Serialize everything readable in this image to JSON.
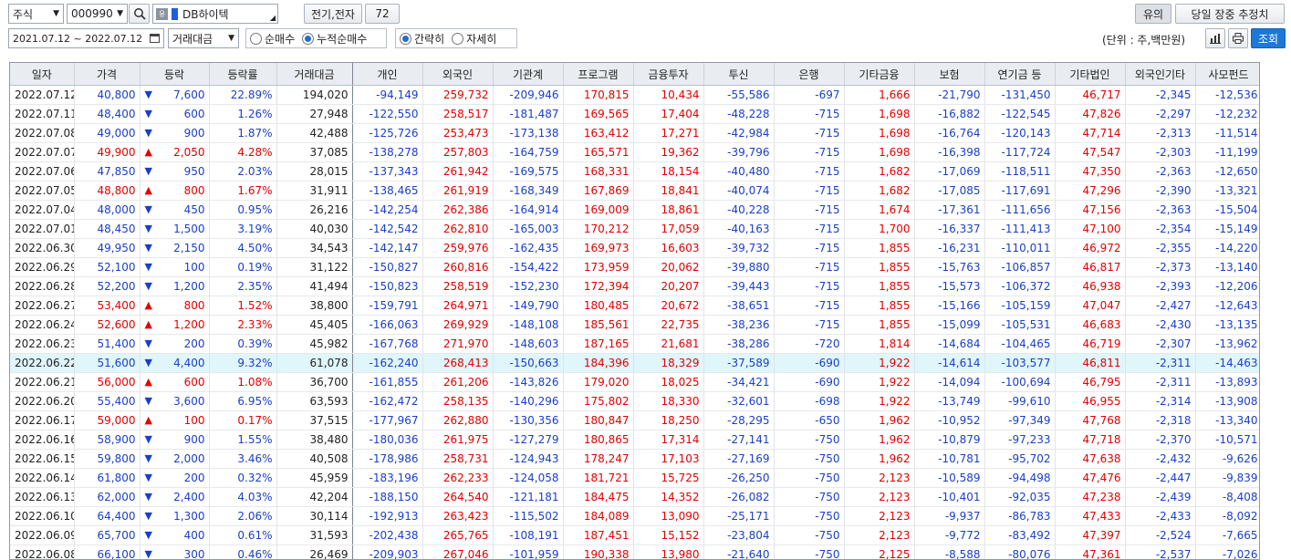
{
  "toolbar": {
    "market": "주식",
    "code": "000990",
    "stock_name": "DB하이텍",
    "sector": "전기,전자",
    "sector_code": "72",
    "notice_btn": "유의",
    "estimate_btn": "당일 장중 추정치",
    "date_range": "2021.07.12 ~ 2022.07.12",
    "value_type": "거래대금",
    "radio_net": "순매수",
    "radio_cum": "누적순매수",
    "radio_simple": "간략히",
    "radio_detail": "자세히",
    "unit": "(단위 : 주,백만원)",
    "query_btn": "조회"
  },
  "columns": [
    "일자",
    "가격",
    "등락",
    "등락률",
    "거래대금",
    "개인",
    "외국인",
    "기관계",
    "프로그램",
    "금융투자",
    "투신",
    "은행",
    "기타금융",
    "보험",
    "연기금 등",
    "기타법인",
    "외국인기타",
    "사모펀드"
  ],
  "rows": [
    [
      "2022.07.12",
      "40,800",
      "▼",
      "7,600",
      "22.89%",
      "194,020",
      "-94,149",
      "259,732",
      "-209,946",
      "170,815",
      "10,434",
      "-55,586",
      "-697",
      "1,666",
      "-21,790",
      "-131,450",
      "46,717",
      "-2,345",
      "-12,536"
    ],
    [
      "2022.07.11",
      "48,400",
      "▼",
      "600",
      "1.26%",
      "27,948",
      "-122,550",
      "258,517",
      "-181,487",
      "169,565",
      "17,404",
      "-48,228",
      "-715",
      "1,698",
      "-16,882",
      "-122,545",
      "47,826",
      "-2,297",
      "-12,232"
    ],
    [
      "2022.07.08",
      "49,000",
      "▼",
      "900",
      "1.87%",
      "42,488",
      "-125,726",
      "253,473",
      "-173,138",
      "163,412",
      "17,271",
      "-42,984",
      "-715",
      "1,698",
      "-16,764",
      "-120,143",
      "47,714",
      "-2,313",
      "-11,514"
    ],
    [
      "2022.07.07",
      "49,900",
      "▲",
      "2,050",
      "4.28%",
      "37,085",
      "-138,278",
      "257,803",
      "-164,759",
      "165,571",
      "19,362",
      "-39,796",
      "-715",
      "1,698",
      "-16,398",
      "-117,724",
      "47,547",
      "-2,303",
      "-11,199"
    ],
    [
      "2022.07.06",
      "47,850",
      "▼",
      "950",
      "2.03%",
      "28,015",
      "-137,343",
      "261,942",
      "-169,575",
      "168,331",
      "18,154",
      "-40,480",
      "-715",
      "1,682",
      "-17,069",
      "-118,511",
      "47,350",
      "-2,363",
      "-12,650"
    ],
    [
      "2022.07.05",
      "48,800",
      "▲",
      "800",
      "1.67%",
      "31,911",
      "-138,465",
      "261,919",
      "-168,349",
      "167,869",
      "18,841",
      "-40,074",
      "-715",
      "1,682",
      "-17,085",
      "-117,691",
      "47,296",
      "-2,390",
      "-13,321"
    ],
    [
      "2022.07.04",
      "48,000",
      "▼",
      "450",
      "0.95%",
      "26,216",
      "-142,254",
      "262,386",
      "-164,914",
      "169,009",
      "18,861",
      "-40,228",
      "-715",
      "1,674",
      "-17,361",
      "-111,656",
      "47,156",
      "-2,363",
      "-15,504"
    ],
    [
      "2022.07.01",
      "48,450",
      "▼",
      "1,500",
      "3.19%",
      "40,030",
      "-142,542",
      "262,810",
      "-165,003",
      "170,212",
      "17,059",
      "-40,163",
      "-715",
      "1,700",
      "-16,337",
      "-111,413",
      "47,100",
      "-2,354",
      "-15,149"
    ],
    [
      "2022.06.30",
      "49,950",
      "▼",
      "2,150",
      "4.50%",
      "34,543",
      "-142,147",
      "259,976",
      "-162,435",
      "169,973",
      "16,603",
      "-39,732",
      "-715",
      "1,855",
      "-16,231",
      "-110,011",
      "46,972",
      "-2,355",
      "-14,220"
    ],
    [
      "2022.06.29",
      "52,100",
      "▼",
      "100",
      "0.19%",
      "31,122",
      "-150,827",
      "260,816",
      "-154,422",
      "173,959",
      "20,062",
      "-39,880",
      "-715",
      "1,855",
      "-15,763",
      "-106,857",
      "46,817",
      "-2,373",
      "-13,140"
    ],
    [
      "2022.06.28",
      "52,200",
      "▼",
      "1,200",
      "2.35%",
      "41,494",
      "-150,823",
      "258,519",
      "-152,230",
      "172,394",
      "20,207",
      "-39,443",
      "-715",
      "1,855",
      "-15,573",
      "-106,372",
      "46,938",
      "-2,393",
      "-12,206"
    ],
    [
      "2022.06.27",
      "53,400",
      "▲",
      "800",
      "1.52%",
      "38,800",
      "-159,791",
      "264,971",
      "-149,790",
      "180,485",
      "20,672",
      "-38,651",
      "-715",
      "1,855",
      "-15,166",
      "-105,159",
      "47,047",
      "-2,427",
      "-12,643"
    ],
    [
      "2022.06.24",
      "52,600",
      "▲",
      "1,200",
      "2.33%",
      "45,405",
      "-166,063",
      "269,929",
      "-148,108",
      "185,561",
      "22,735",
      "-38,236",
      "-715",
      "1,855",
      "-15,099",
      "-105,531",
      "46,683",
      "-2,430",
      "-13,135"
    ],
    [
      "2022.06.23",
      "51,400",
      "▼",
      "200",
      "0.39%",
      "45,982",
      "-167,768",
      "271,970",
      "-148,603",
      "187,165",
      "21,681",
      "-38,286",
      "-720",
      "1,814",
      "-14,684",
      "-104,465",
      "46,719",
      "-2,307",
      "-13,962"
    ],
    [
      "2022.06.22",
      "51,600",
      "▼",
      "4,400",
      "9.32%",
      "61,078",
      "-162,240",
      "268,413",
      "-150,663",
      "184,396",
      "18,329",
      "-37,589",
      "-690",
      "1,922",
      "-14,614",
      "-103,577",
      "46,811",
      "-2,311",
      "-14,463"
    ],
    [
      "2022.06.21",
      "56,000",
      "▲",
      "600",
      "1.08%",
      "36,700",
      "-161,855",
      "261,206",
      "-143,826",
      "179,020",
      "18,025",
      "-34,421",
      "-690",
      "1,922",
      "-14,094",
      "-100,694",
      "46,795",
      "-2,311",
      "-13,893"
    ],
    [
      "2022.06.20",
      "55,400",
      "▼",
      "3,600",
      "6.95%",
      "63,593",
      "-162,472",
      "258,135",
      "-140,296",
      "175,802",
      "18,330",
      "-32,601",
      "-698",
      "1,922",
      "-13,749",
      "-99,610",
      "46,955",
      "-2,314",
      "-13,908"
    ],
    [
      "2022.06.17",
      "59,000",
      "▲",
      "100",
      "0.17%",
      "37,515",
      "-177,967",
      "262,880",
      "-130,356",
      "180,847",
      "18,250",
      "-28,295",
      "-650",
      "1,962",
      "-10,952",
      "-97,349",
      "47,768",
      "-2,318",
      "-13,340"
    ],
    [
      "2022.06.16",
      "58,900",
      "▼",
      "900",
      "1.55%",
      "38,480",
      "-180,036",
      "261,975",
      "-127,279",
      "180,865",
      "17,314",
      "-27,141",
      "-750",
      "1,962",
      "-10,879",
      "-97,233",
      "47,718",
      "-2,370",
      "-10,571"
    ],
    [
      "2022.06.15",
      "59,800",
      "▼",
      "2,000",
      "3.46%",
      "40,508",
      "-178,986",
      "258,731",
      "-124,943",
      "178,247",
      "17,103",
      "-27,169",
      "-750",
      "1,962",
      "-10,781",
      "-95,702",
      "47,638",
      "-2,432",
      "-9,626"
    ],
    [
      "2022.06.14",
      "61,800",
      "▼",
      "200",
      "0.32%",
      "45,959",
      "-183,196",
      "262,233",
      "-124,058",
      "181,721",
      "15,725",
      "-26,250",
      "-750",
      "2,123",
      "-10,589",
      "-94,498",
      "47,476",
      "-2,447",
      "-9,839"
    ],
    [
      "2022.06.13",
      "62,000",
      "▼",
      "2,400",
      "4.03%",
      "42,204",
      "-188,150",
      "264,540",
      "-121,181",
      "184,475",
      "14,352",
      "-26,082",
      "-750",
      "2,123",
      "-10,401",
      "-92,035",
      "47,238",
      "-2,439",
      "-8,408"
    ],
    [
      "2022.06.10",
      "64,400",
      "▼",
      "1,300",
      "2.06%",
      "30,114",
      "-192,913",
      "263,423",
      "-115,502",
      "184,089",
      "13,090",
      "-25,171",
      "-750",
      "2,123",
      "-9,937",
      "-86,783",
      "47,433",
      "-2,433",
      "-8,092"
    ],
    [
      "2022.06.09",
      "65,700",
      "▼",
      "400",
      "0.61%",
      "31,593",
      "-202,438",
      "265,765",
      "-108,191",
      "187,451",
      "15,152",
      "-23,804",
      "-750",
      "2,123",
      "-9,772",
      "-83,492",
      "47,397",
      "-2,524",
      "-7,665"
    ],
    [
      "2022.06.08",
      "66,100",
      "▼",
      "300",
      "0.46%",
      "26,469",
      "-209,903",
      "267,046",
      "-101,959",
      "190,338",
      "13,980",
      "-21,640",
      "-750",
      "2,125",
      "-8,588",
      "-80,076",
      "47,361",
      "-2,537",
      "-7,026"
    ]
  ],
  "selected_row": 14,
  "colors": {
    "up": "#e20000",
    "down": "#1a3fc8",
    "selected": "#dff6fb",
    "header": "#e9edf2",
    "accent": "#1e78d7"
  }
}
